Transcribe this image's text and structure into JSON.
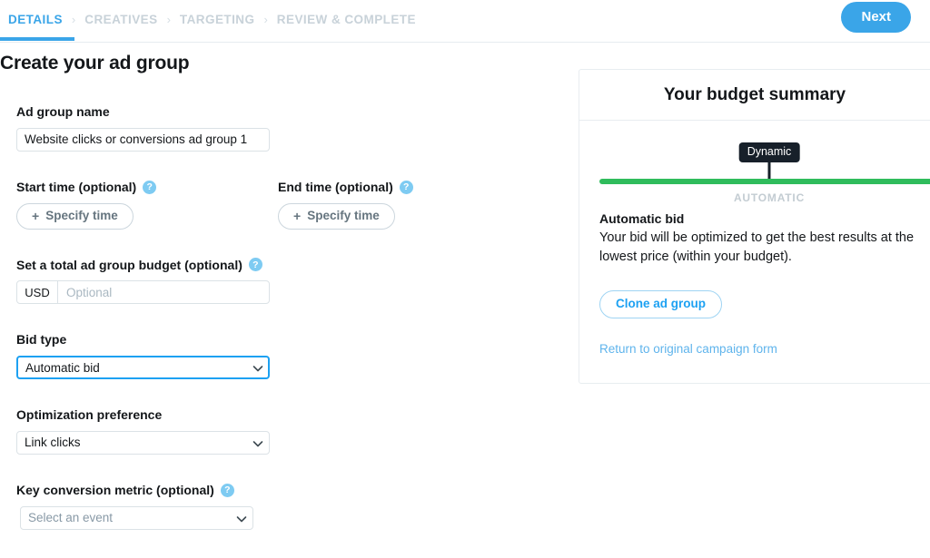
{
  "steps": {
    "items": [
      {
        "label": "DETAILS",
        "active": true
      },
      {
        "label": "CREATIVES",
        "active": false
      },
      {
        "label": "TARGETING",
        "active": false
      },
      {
        "label": "REVIEW & COMPLETE",
        "active": false
      }
    ],
    "separator": "›",
    "next_label": "Next"
  },
  "page": {
    "title": "Create your ad group"
  },
  "form": {
    "ad_group_name": {
      "label": "Ad group name",
      "value": "Website clicks or conversions ad group 1"
    },
    "start_time": {
      "label": "Start time (optional)",
      "help": "?",
      "button_label": "Specify time",
      "button_plus": "+"
    },
    "end_time": {
      "label": "End time (optional)",
      "help": "?",
      "button_label": "Specify time",
      "button_plus": "+"
    },
    "budget": {
      "label": "Set a total ad group budget (optional)",
      "help": "?",
      "currency": "USD",
      "placeholder": "Optional",
      "value": ""
    },
    "bid_type": {
      "label": "Bid type",
      "value": "Automatic bid"
    },
    "optimization": {
      "label": "Optimization preference",
      "value": "Link clicks"
    },
    "key_conversion": {
      "label": "Key conversion metric (optional)",
      "help": "?",
      "value": "Select an event"
    }
  },
  "summary": {
    "title": "Your budget summary",
    "meter": {
      "badge": "Dynamic",
      "caption": "AUTOMATIC",
      "bar_color": "#2fbc5c",
      "position_percent": 50
    },
    "bid_heading": "Automatic bid",
    "bid_description": "Your bid will be optimized to get the best results at the lowest price (within your budget).",
    "clone_label": "Clone ad group",
    "return_label": "Return to original campaign form"
  },
  "colors": {
    "accent_blue": "#1da1f2",
    "step_active": "#3aa5e8",
    "green": "#2fbc5c",
    "badge_dark": "#17202a"
  }
}
